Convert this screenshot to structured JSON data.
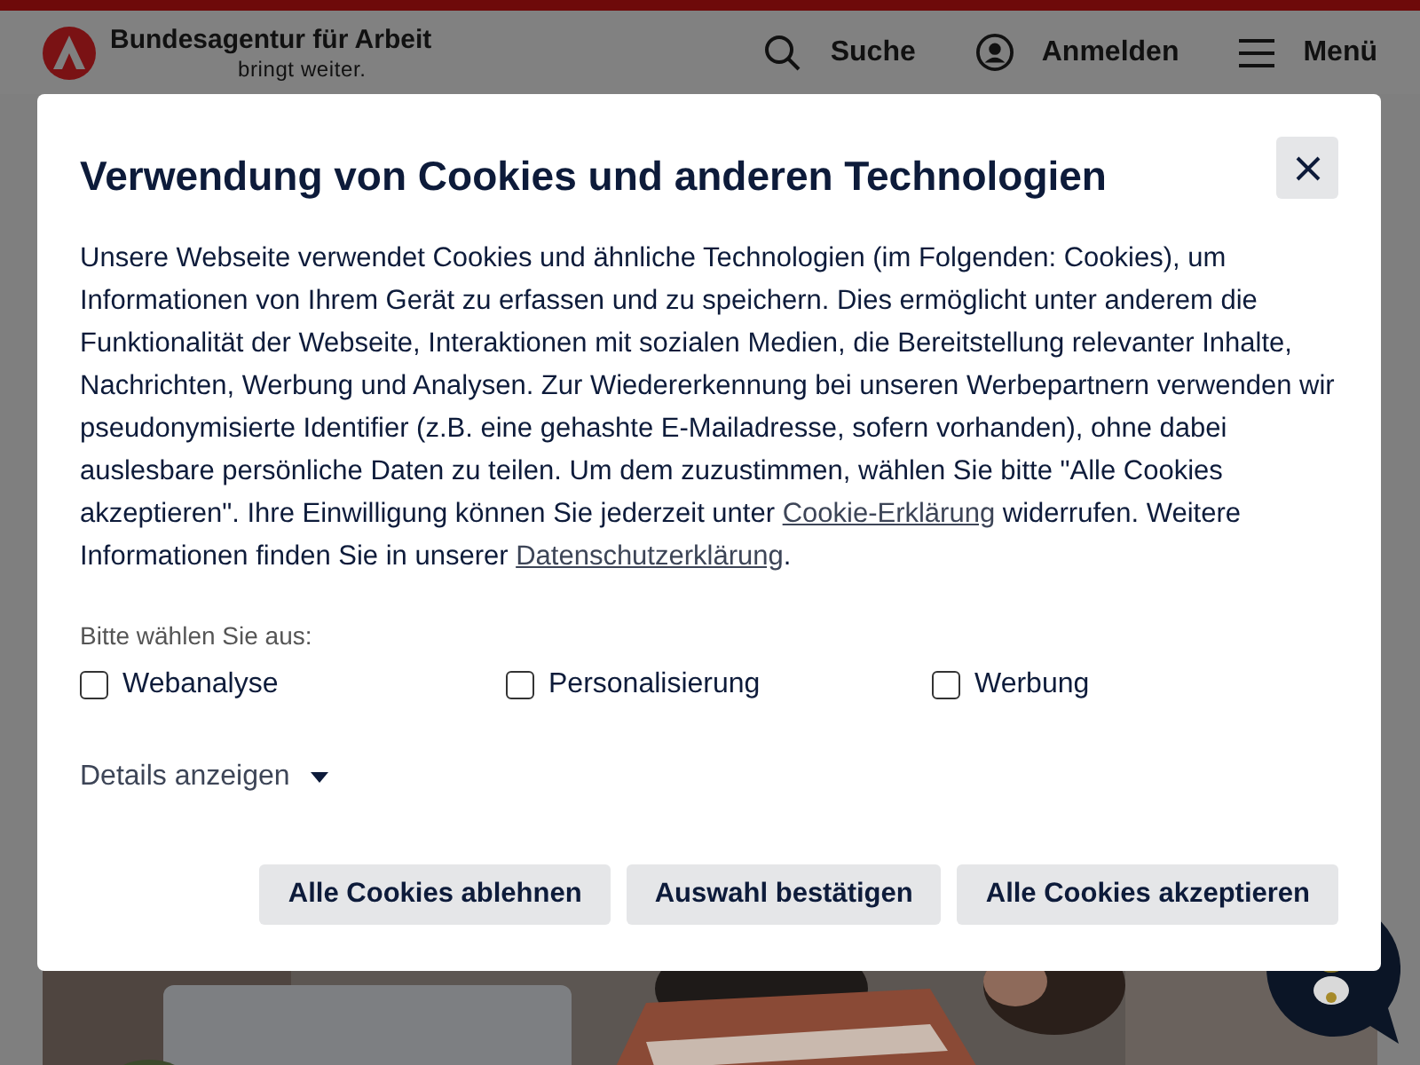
{
  "header": {
    "brand": "Bundesagentur für Arbeit",
    "slogan": "bringt weiter.",
    "actions": [
      {
        "kind": "search",
        "label": "Suche"
      },
      {
        "kind": "login",
        "label": "Anmelden"
      },
      {
        "kind": "menu",
        "label": "Menü"
      }
    ]
  },
  "dialog": {
    "title": "Verwendung von Cookies und anderen Technologien",
    "intro": [
      {
        "kind": "text",
        "text": "Unsere Webseite verwendet Cookies und ähnliche Technologien (im Folgenden: Cookies), um Informationen von Ihrem Gerät zu erfassen und zu speichern. Dies ermöglicht unter anderem die Funktionalität der Webseite, Interaktionen mit sozialen Medien, die Bereitstellung relevanter Inhalte, Nachrichten, Werbung und Analysen. Zur Wiedererkennung bei unseren Werbepartnern verwenden wir pseudonymisierte Identifier (z.B. eine gehashte E-Mailadresse, sofern vorhanden), ohne dabei auslesbare persönliche Daten zu teilen. Um dem zuzustimmen, wählen Sie bitte \"Alle Cookies akzeptieren\". Ihre Einwilligung können Sie jederzeit unter "
      },
      {
        "kind": "link",
        "text": "Cookie-Erklärung"
      },
      {
        "kind": "text",
        "text": " widerrufen. Weitere Informationen finden Sie in unserer "
      },
      {
        "kind": "link",
        "text": "Datenschutzerklärung"
      },
      {
        "kind": "text",
        "text": "."
      }
    ],
    "choose_label": "Bitte wählen Sie aus:",
    "options": [
      {
        "label": "Webanalyse",
        "checked": false
      },
      {
        "label": "Personalisierung",
        "checked": false
      },
      {
        "label": "Werbung",
        "checked": false
      }
    ],
    "details": {
      "label": "Details anzeigen",
      "expanded": false
    },
    "buttons": [
      "Alle Cookies ablehnen",
      "Auswahl bestätigen",
      "Alle Cookies akzeptieren"
    ]
  }
}
